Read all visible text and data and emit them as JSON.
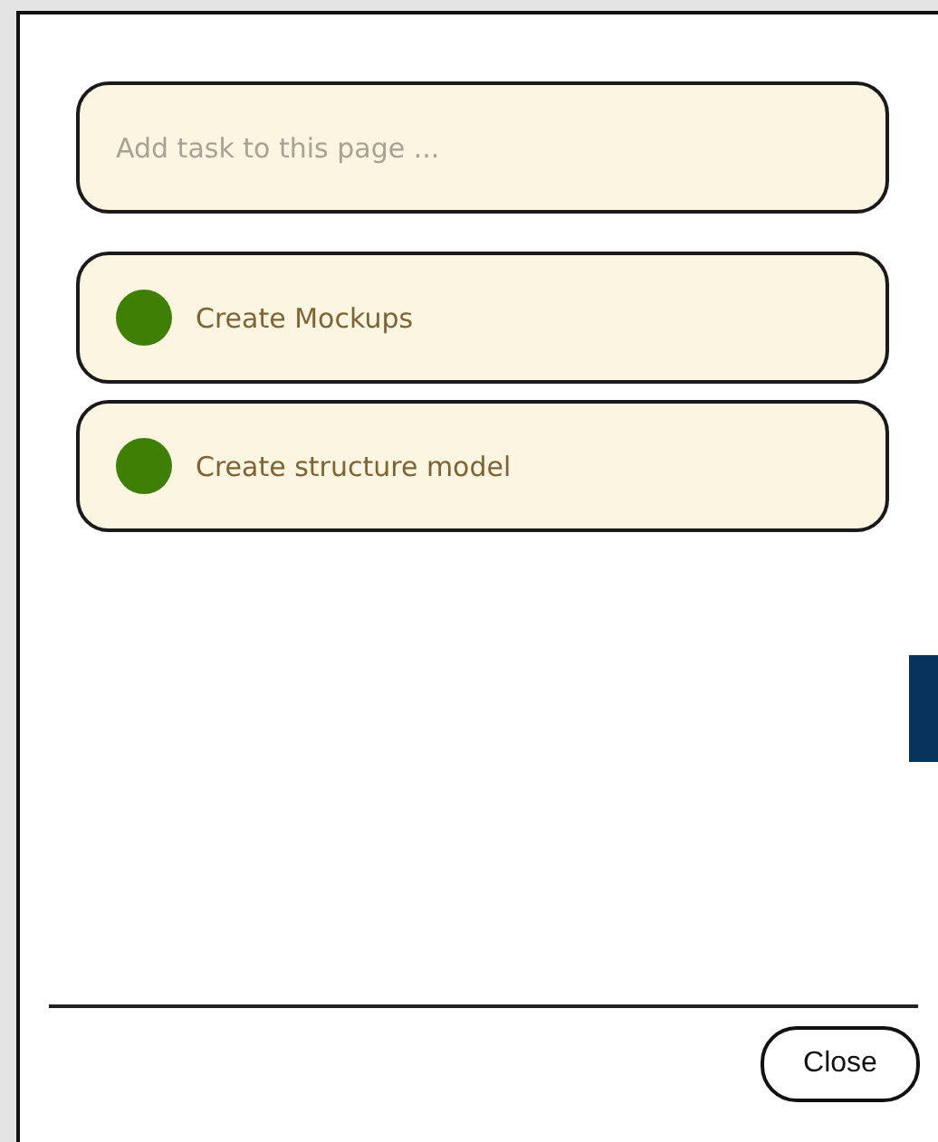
{
  "task_input": {
    "placeholder": "Add task to this page ..."
  },
  "tasks": [
    {
      "label": "Create Mockups"
    },
    {
      "label": "Create structure model"
    }
  ],
  "buttons": [
    {
      "label": "Close"
    }
  ]
}
